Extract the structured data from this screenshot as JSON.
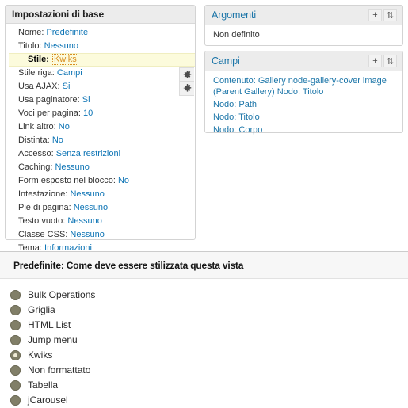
{
  "basic_settings": {
    "title": "Impostazioni di base",
    "rows": [
      {
        "label": "Nome:",
        "value": "Predefinite",
        "state": "normal"
      },
      {
        "label": "Titolo:",
        "value": "Nessuno",
        "state": "normal"
      },
      {
        "label": "Stile:",
        "value": "Kwiks",
        "state": "highlight"
      },
      {
        "label": "Stile riga:",
        "value": "Campi",
        "state": "normal"
      },
      {
        "label": "Usa AJAX:",
        "value": "Si",
        "state": "normal"
      },
      {
        "label": "Usa paginatore:",
        "value": "Si",
        "state": "normal"
      },
      {
        "label": "Voci per pagina:",
        "value": "10",
        "state": "normal"
      },
      {
        "label": "Link altro:",
        "value": "No",
        "state": "normal"
      },
      {
        "label": "Distinta:",
        "value": "No",
        "state": "normal"
      },
      {
        "label": "Accesso:",
        "value": "Senza restrizioni",
        "state": "normal"
      },
      {
        "label": "Caching:",
        "value": "Nessuno",
        "state": "normal"
      },
      {
        "label": "Form esposto nel blocco:",
        "value": "No",
        "state": "normal"
      },
      {
        "label": "Intestazione:",
        "value": "Nessuno",
        "state": "normal"
      },
      {
        "label": "Piè di pagina:",
        "value": "Nessuno",
        "state": "normal"
      },
      {
        "label": "Testo vuoto:",
        "value": "Nessuno",
        "state": "normal"
      },
      {
        "label": "Classe CSS:",
        "value": "Nessuno",
        "state": "normal"
      },
      {
        "label": "Tema:",
        "value": "Informazioni",
        "state": "normal"
      }
    ],
    "gear_icons": [
      "gear-icon",
      "gear-icon"
    ]
  },
  "arguments_panel": {
    "title": "Argomenti",
    "add_label": "+",
    "rearrange_label": "⇅",
    "lines": [
      {
        "text": "Non definito",
        "link": false
      }
    ]
  },
  "fields_panel": {
    "title": "Campi",
    "add_label": "+",
    "rearrange_label": "⇅",
    "lines": [
      {
        "text": "Contenuto: Gallery node-gallery-cover image (Parent Gallery) Nodo: Titolo",
        "link": true
      },
      {
        "text": "Nodo: Path",
        "link": true
      },
      {
        "text": "Nodo: Titolo",
        "link": true
      },
      {
        "text": "Nodo: Corpo",
        "link": true
      }
    ]
  },
  "style_form": {
    "header": "Predefinite: Come deve essere stilizzata questa vista",
    "options": [
      {
        "label": "Bulk Operations",
        "selected": false
      },
      {
        "label": "Griglia",
        "selected": false
      },
      {
        "label": "HTML List",
        "selected": false
      },
      {
        "label": "Jump menu",
        "selected": false
      },
      {
        "label": "Kwiks",
        "selected": true
      },
      {
        "label": "Non formattato",
        "selected": false
      },
      {
        "label": "Tabella",
        "selected": false
      },
      {
        "label": "jCarousel",
        "selected": false
      }
    ]
  },
  "colors": {
    "link_blue": "#0d74b5",
    "panel_title_blue": "#1b75a8",
    "focus_orange": "#d98f21",
    "highlight_yellow": "#fcfbdc",
    "radio_fill": "#817f68"
  }
}
